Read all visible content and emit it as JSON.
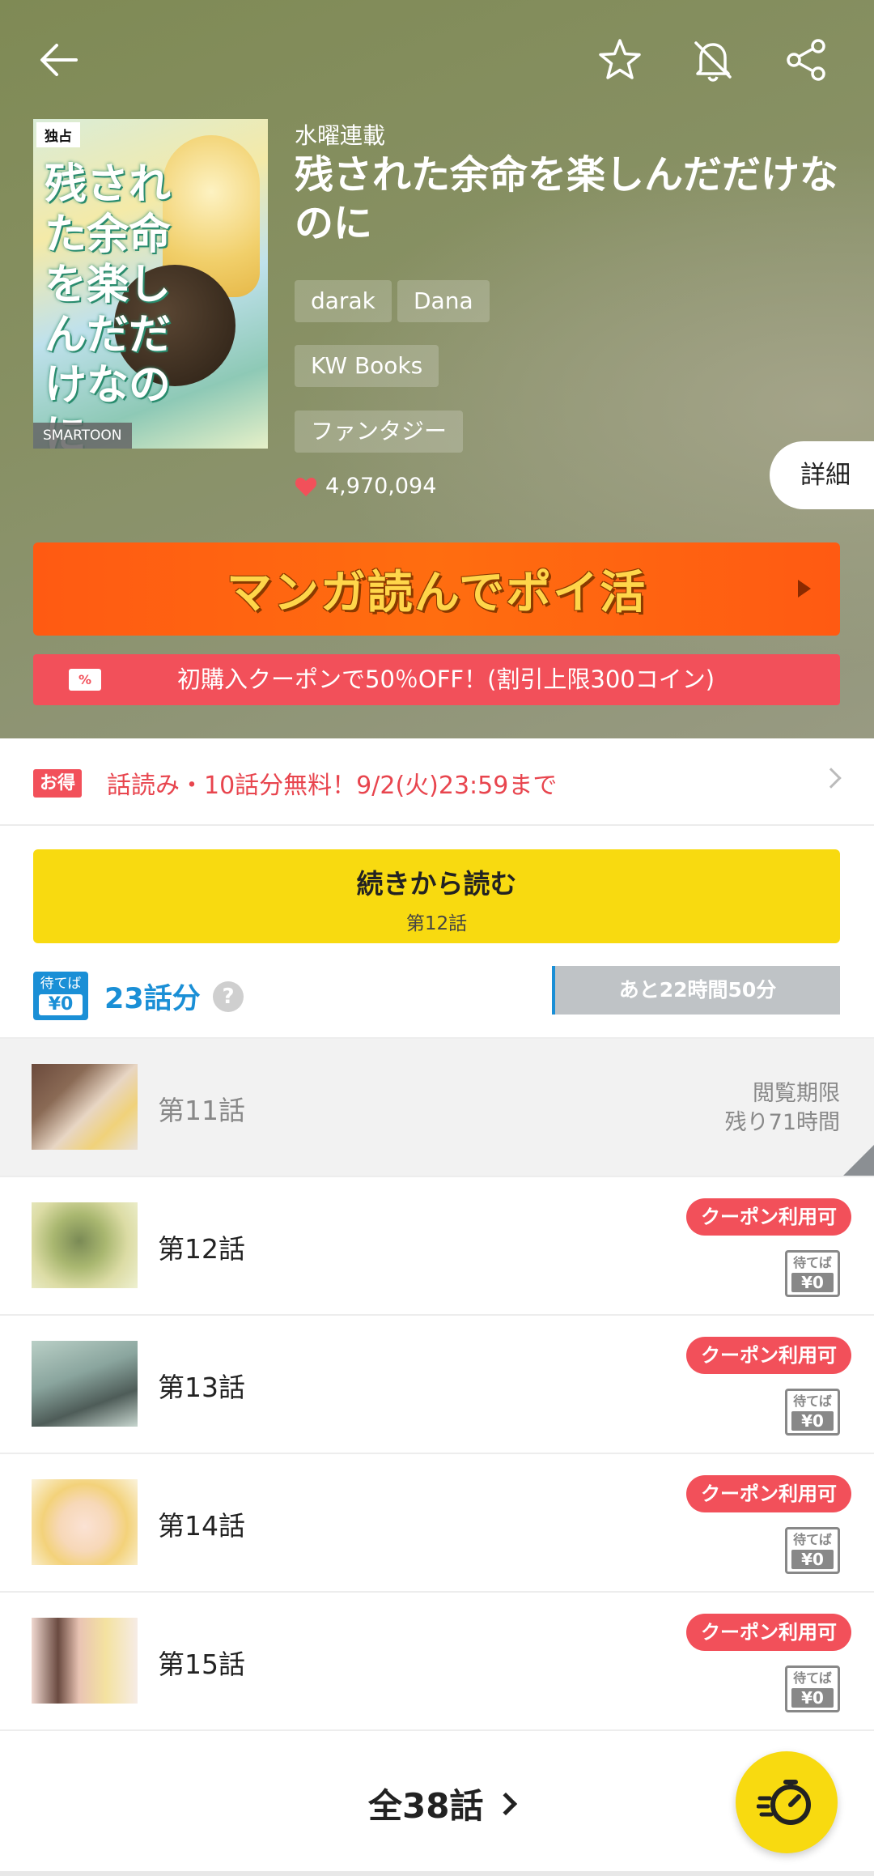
{
  "header": {
    "back_icon": "arrow-left-icon",
    "favorite_icon": "star-icon",
    "notification_icon": "bell-off-icon",
    "share_icon": "share-icon"
  },
  "cover": {
    "badge_exclusive": "独占",
    "cover_title": "残された余命を楽しんだだけなのに",
    "badge_format": "SMARTOON"
  },
  "series": {
    "serial_day": "水曜連載",
    "title": "残された余命を楽しんだだけなのに",
    "authors": [
      "darak",
      "Dana"
    ],
    "publisher": "KW Books",
    "genre": "ファンタジー",
    "likes": "4,970,094",
    "detail_label": "詳細"
  },
  "banner": {
    "poi_text": "マンガ読んでポイ活"
  },
  "coupon": {
    "text": "初購入クーポンで50％OFF！(割引上限300コイン)"
  },
  "promo": {
    "badge": "お得",
    "text": "話読み・10話分無料！9/2(火)23:59まで"
  },
  "continue": {
    "label": "続きから読む",
    "episode": "第12話"
  },
  "wait_free": {
    "badge_top": "待てば",
    "badge_bottom": "¥0",
    "count": "23話分",
    "help": "?",
    "timer": "あと22時間50分"
  },
  "episodes": [
    {
      "title": "第11話",
      "status": "read",
      "expire_line1": "閲覧期限",
      "expire_line2": "残り71時間"
    },
    {
      "title": "第12話",
      "coupon": "クーポン利用可",
      "wait_top": "待てば",
      "wait_bottom": "¥0"
    },
    {
      "title": "第13話",
      "coupon": "クーポン利用可",
      "wait_top": "待てば",
      "wait_bottom": "¥0"
    },
    {
      "title": "第14話",
      "coupon": "クーポン利用可",
      "wait_top": "待てば",
      "wait_bottom": "¥0"
    },
    {
      "title": "第15話",
      "coupon": "クーポン利用可",
      "wait_top": "待てば",
      "wait_bottom": "¥0"
    }
  ],
  "footer": {
    "all_episodes": "全38話",
    "fab_icon": "stopwatch-speed-icon"
  },
  "colors": {
    "accent_yellow": "#f8da10",
    "coupon_red": "#f2505a",
    "wait_blue": "#1a8fd6",
    "poi_orange": "#ff5a12"
  }
}
